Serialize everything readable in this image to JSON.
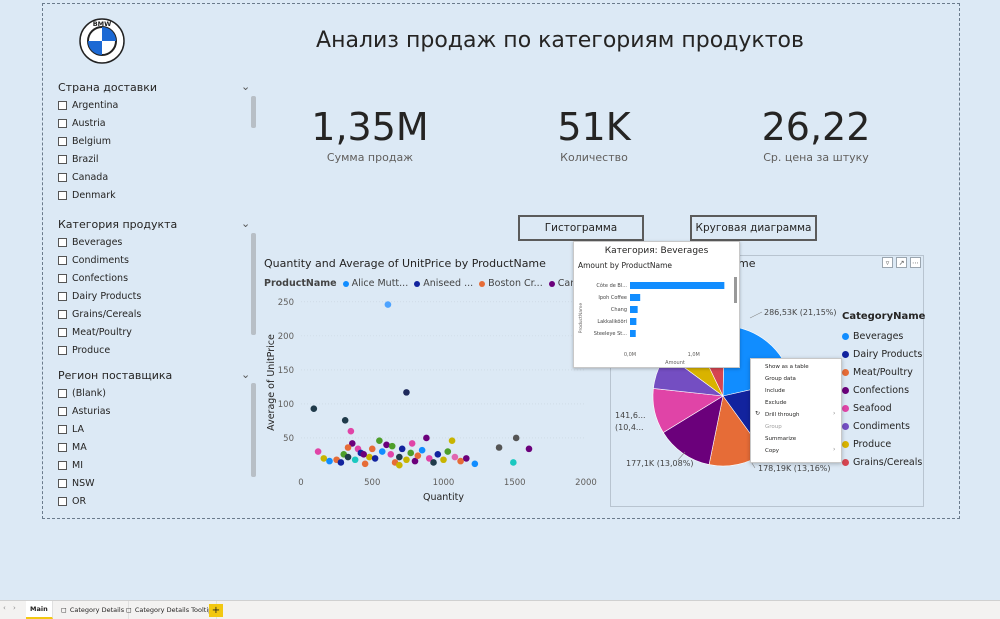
{
  "title": "Анализ продаж по категориям продуктов",
  "logo_text": "BMW",
  "slicers": [
    {
      "title": "Страна доставки",
      "items": [
        "Argentina",
        "Austria",
        "Belgium",
        "Brazil",
        "Canada",
        "Denmark"
      ]
    },
    {
      "title": "Категория продукта",
      "items": [
        "Beverages",
        "Condiments",
        "Confections",
        "Dairy Products",
        "Grains/Cereals",
        "Meat/Poultry",
        "Produce"
      ]
    },
    {
      "title": "Регион поставщика",
      "items": [
        "(Blank)",
        "Asturias",
        "LA",
        "MA",
        "MI",
        "NSW",
        "OR"
      ]
    }
  ],
  "kpis": [
    {
      "value": "1,35M",
      "label": "Сумма продаж"
    },
    {
      "value": "51K",
      "label": "Количество"
    },
    {
      "value": "26,22",
      "label": "Ср. цена за штуку"
    }
  ],
  "buttons": {
    "histogram": "Гистограмма",
    "pie": "Круговая диаграмма"
  },
  "scatter": {
    "title": "Quantity and Average of UnitPrice by ProductName",
    "legend_label": "ProductName",
    "legend_items": [
      {
        "name": "Alice Mutt...",
        "color": "#118dff"
      },
      {
        "name": "Aniseed ...",
        "color": "#12239e"
      },
      {
        "name": "Boston Cr...",
        "color": "#e66c37"
      },
      {
        "name": "Camem...",
        "color": "#6b007b"
      }
    ],
    "xlabel": "Quantity",
    "ylabel": "Average of UnitPrice",
    "x_ticks": [
      "0",
      "500",
      "1000",
      "1500",
      "2000"
    ],
    "y_ticks": [
      "50",
      "100",
      "150",
      "200",
      "250"
    ]
  },
  "chart_data": [
    {
      "type": "scatter",
      "title": "Quantity and Average of UnitPrice by ProductName",
      "xlabel": "Quantity",
      "ylabel": "Average of UnitPrice",
      "xlim": [
        0,
        2000
      ],
      "ylim": [
        0,
        263
      ],
      "points": [
        {
          "x": 610,
          "y": 246,
          "c": "#4da3ff"
        },
        {
          "x": 740,
          "y": 117,
          "c": "#1f2a5c"
        },
        {
          "x": 90,
          "y": 93,
          "c": "#1f3a4a"
        },
        {
          "x": 310,
          "y": 76,
          "c": "#1f3a4a"
        },
        {
          "x": 1510,
          "y": 50,
          "c": "#555"
        },
        {
          "x": 1600,
          "y": 34,
          "c": "#6b007b"
        },
        {
          "x": 1390,
          "y": 36,
          "c": "#555"
        },
        {
          "x": 1490,
          "y": 14,
          "c": "#1ac8c0"
        },
        {
          "x": 1060,
          "y": 46,
          "c": "#c8b400"
        },
        {
          "x": 880,
          "y": 50,
          "c": "#6b007b"
        },
        {
          "x": 350,
          "y": 60,
          "c": "#e044a7"
        },
        {
          "x": 120,
          "y": 30,
          "c": "#e044a7"
        },
        {
          "x": 160,
          "y": 20,
          "c": "#c8b400"
        },
        {
          "x": 200,
          "y": 16,
          "c": "#118dff"
        },
        {
          "x": 250,
          "y": 18,
          "c": "#e66c37"
        },
        {
          "x": 300,
          "y": 26,
          "c": "#4d9e2a"
        },
        {
          "x": 330,
          "y": 22,
          "c": "#1f3a4a"
        },
        {
          "x": 360,
          "y": 42,
          "c": "#6b007b"
        },
        {
          "x": 400,
          "y": 34,
          "c": "#e044a7"
        },
        {
          "x": 420,
          "y": 28,
          "c": "#12239e"
        },
        {
          "x": 450,
          "y": 12,
          "c": "#e66c37"
        },
        {
          "x": 480,
          "y": 22,
          "c": "#c8b400"
        },
        {
          "x": 520,
          "y": 20,
          "c": "#12239e"
        },
        {
          "x": 550,
          "y": 46,
          "c": "#4d9e2a"
        },
        {
          "x": 570,
          "y": 30,
          "c": "#118dff"
        },
        {
          "x": 600,
          "y": 40,
          "c": "#6b007b"
        },
        {
          "x": 630,
          "y": 26,
          "c": "#e044a7"
        },
        {
          "x": 660,
          "y": 14,
          "c": "#e66c37"
        },
        {
          "x": 690,
          "y": 22,
          "c": "#1f3a4a"
        },
        {
          "x": 710,
          "y": 34,
          "c": "#12239e"
        },
        {
          "x": 740,
          "y": 18,
          "c": "#c8b400"
        },
        {
          "x": 770,
          "y": 28,
          "c": "#4d9e2a"
        },
        {
          "x": 800,
          "y": 16,
          "c": "#6b007b"
        },
        {
          "x": 820,
          "y": 24,
          "c": "#e66c37"
        },
        {
          "x": 850,
          "y": 32,
          "c": "#118dff"
        },
        {
          "x": 900,
          "y": 20,
          "c": "#e044a7"
        },
        {
          "x": 930,
          "y": 14,
          "c": "#1f3a4a"
        },
        {
          "x": 960,
          "y": 26,
          "c": "#12239e"
        },
        {
          "x": 1000,
          "y": 18,
          "c": "#c8b400"
        },
        {
          "x": 1030,
          "y": 30,
          "c": "#4d9e2a"
        },
        {
          "x": 1080,
          "y": 22,
          "c": "#e066b0"
        },
        {
          "x": 1120,
          "y": 16,
          "c": "#e66c37"
        },
        {
          "x": 1160,
          "y": 20,
          "c": "#6b007b"
        },
        {
          "x": 1220,
          "y": 12,
          "c": "#118dff"
        },
        {
          "x": 280,
          "y": 14,
          "c": "#12239e"
        },
        {
          "x": 380,
          "y": 18,
          "c": "#1ac8c0"
        },
        {
          "x": 500,
          "y": 34,
          "c": "#e66c37"
        },
        {
          "x": 640,
          "y": 38,
          "c": "#4d9e2a"
        },
        {
          "x": 780,
          "y": 42,
          "c": "#e044a7"
        },
        {
          "x": 690,
          "y": 10,
          "c": "#c8b400"
        },
        {
          "x": 330,
          "y": 36,
          "c": "#e66c37"
        },
        {
          "x": 440,
          "y": 26,
          "c": "#6b007b"
        }
      ]
    },
    {
      "type": "bar",
      "title": "Amount by ProductName",
      "categories": [
        "Côte de Bl...",
        "Ipoh Coffee",
        "Chang",
        "Lakkalikööri",
        "Steeleye St..."
      ],
      "values": [
        1.48,
        0.16,
        0.12,
        0.1,
        0.09
      ],
      "x_ticks": [
        "0,0M",
        "1,0M"
      ],
      "xlabel": "Amount",
      "ylabel": "ProductName",
      "xlim": [
        0,
        1.6
      ]
    },
    {
      "type": "pie",
      "slices": [
        {
          "name": "Beverages",
          "value": 286.53,
          "color": "#118dff"
        },
        {
          "name": "Dairy Products",
          "value": 251.33,
          "color": "#12239e"
        },
        {
          "name": "Meat/Poultry",
          "value": 178.19,
          "color": "#e66c37"
        },
        {
          "name": "Confections",
          "value": 177.1,
          "color": "#6b007b"
        },
        {
          "name": "Seafood",
          "value": 141.6,
          "color": "#e044a7"
        },
        {
          "name": "Condiments",
          "value": 113.69,
          "color": "#744ec2"
        },
        {
          "name": "Produce",
          "value": 105.27,
          "color": "#d9b300"
        },
        {
          "name": "Grains/Cereals",
          "value": 100.73,
          "color": "#d64550"
        }
      ],
      "labels": [
        "286,53K (21,15%)",
        "178,19K (13,16%)",
        "177,1K (13,08%)",
        "141,6...",
        "(10,4..."
      ]
    }
  ],
  "tooltip": {
    "category_line": "Категория: Beverages",
    "chart_title": "Amount by ProductName"
  },
  "pie_legend": {
    "title": "CategoryName",
    "items": [
      {
        "name": "Beverages",
        "color": "#118dff"
      },
      {
        "name": "Dairy Products",
        "color": "#12239e"
      },
      {
        "name": "Meat/Poultry",
        "color": "#e66c37"
      },
      {
        "name": "Confections",
        "color": "#6b007b"
      },
      {
        "name": "Seafood",
        "color": "#e044a7"
      },
      {
        "name": "Condiments",
        "color": "#744ec2"
      },
      {
        "name": "Produce",
        "color": "#d9b300"
      },
      {
        "name": "Grains/Cereals",
        "color": "#d64550"
      }
    ]
  },
  "pie_title_fragment": "me",
  "context_menu": [
    "Show as a table",
    "Group data",
    "Include",
    "Exclude",
    "Drill through",
    "Group",
    "Summarize",
    "Copy"
  ],
  "tabs": [
    "Main",
    "Category Details",
    "Category Details Tooltip"
  ],
  "add_tab": "+"
}
